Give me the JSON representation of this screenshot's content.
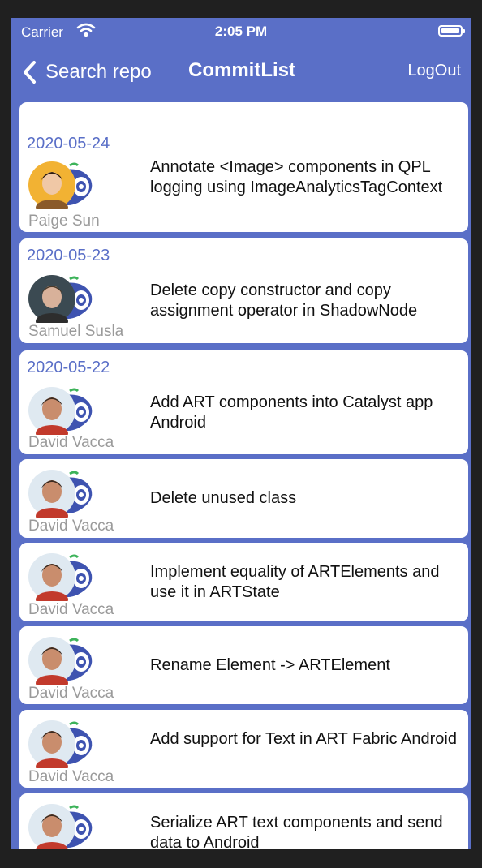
{
  "status_bar": {
    "carrier": "Carrier",
    "time": "2:05 PM",
    "wifi_icon": "wifi-icon",
    "battery_icon": "battery-icon"
  },
  "nav": {
    "back_label": "Search repo",
    "title": "CommitList",
    "logout_label": "LogOut",
    "back_icon": "chevron-left-icon"
  },
  "colors": {
    "accent": "#5a6fc7",
    "background": "#202020",
    "card": "#ffffff",
    "author": "#9a9a9a"
  },
  "commits": [
    {
      "date": "2020-05-24",
      "author": "Paige Sun",
      "message": "Annotate <Image> components in QPL logging using ImageAnalyticsTagContext"
    },
    {
      "date": "2020-05-23",
      "author": "Samuel Susla",
      "message": "Delete copy constructor and copy assignment operator in ShadowNode"
    },
    {
      "date": "2020-05-22",
      "author": "David Vacca",
      "message": "Add ART components into Catalyst app Android"
    },
    {
      "date": "",
      "author": "David Vacca",
      "message": "Delete unused class"
    },
    {
      "date": "",
      "author": "David Vacca",
      "message": "Implement equality of ARTElements and use it in ARTState"
    },
    {
      "date": "",
      "author": "David Vacca",
      "message": "Rename Element -> ARTElement"
    },
    {
      "date": "",
      "author": "David Vacca",
      "message": "Add support for Text in ART Fabric Android"
    },
    {
      "date": "",
      "author": "",
      "message": "Serialize ART text components and send data to Android"
    }
  ]
}
